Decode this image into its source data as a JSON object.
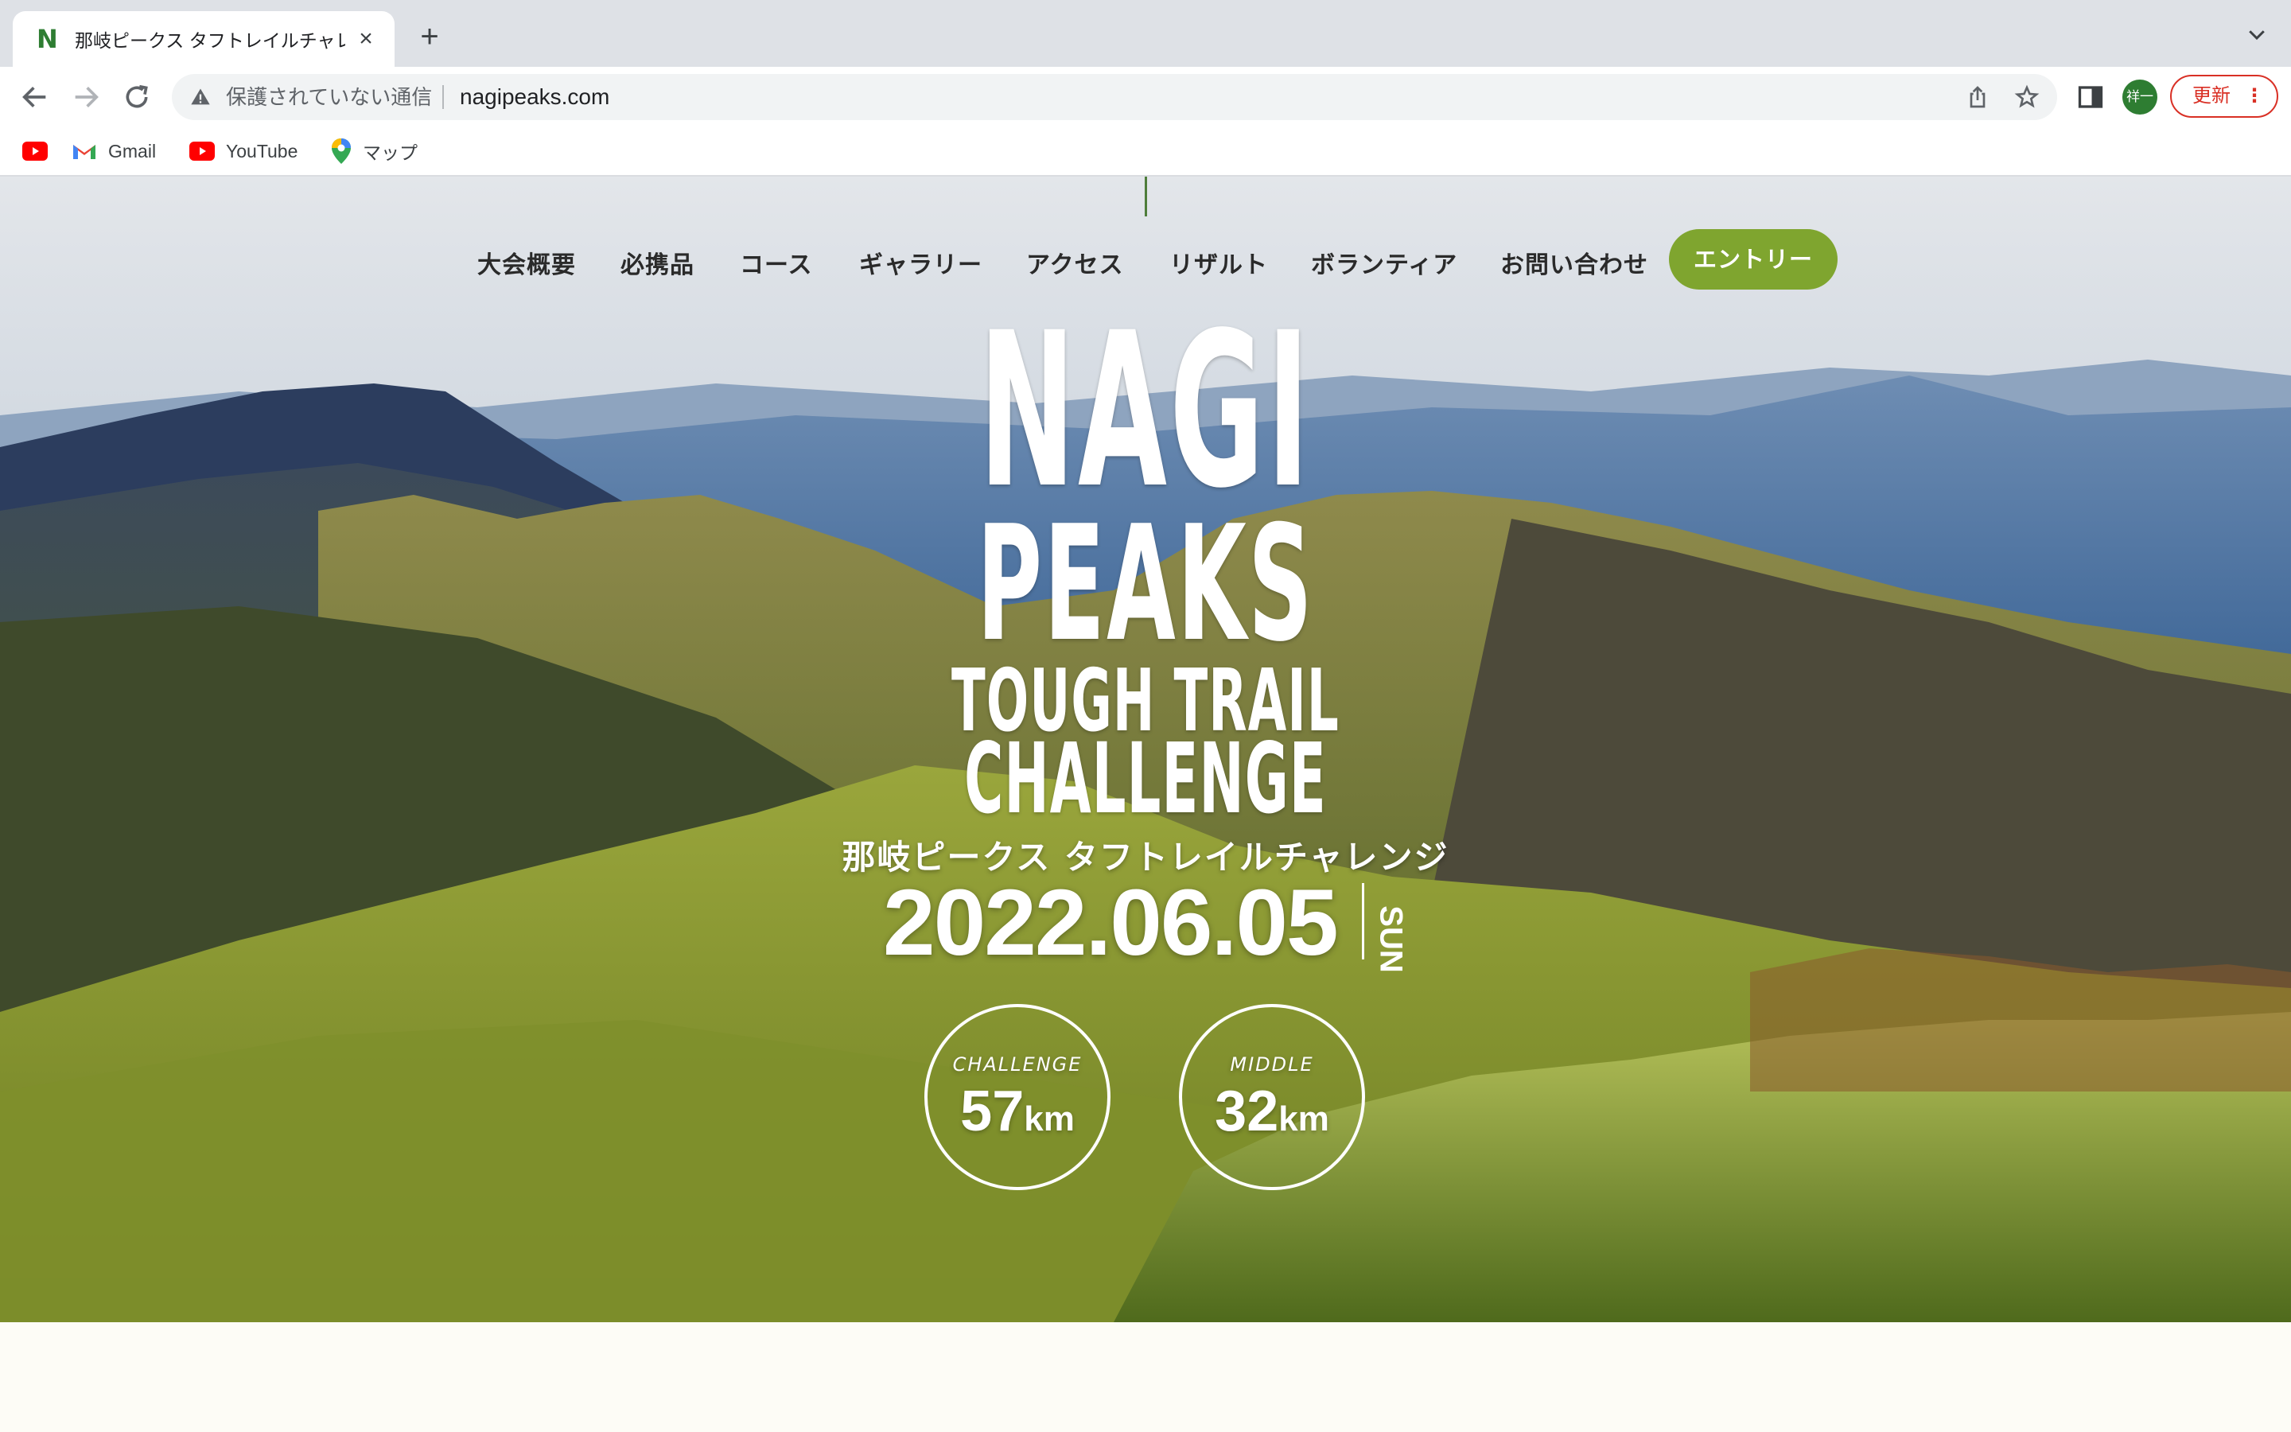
{
  "browser": {
    "tab": {
      "title": "那岐ピークス タフトレイルチャレンジ",
      "favicon_letter": "N"
    },
    "new_tab_symbol": "+",
    "close_symbol": "×",
    "omnibox": {
      "security_label": "保護されていない通信",
      "url": "nagipeaks.com"
    },
    "profile_initial": "祥一",
    "update_label": "更新",
    "update_menu": "⋮",
    "bookmarks": [
      {
        "label": "",
        "icon": "youtube-icon"
      },
      {
        "label": "Gmail",
        "icon": "gmail-icon"
      },
      {
        "label": "YouTube",
        "icon": "youtube-icon"
      },
      {
        "label": "マップ",
        "icon": "maps-icon"
      }
    ]
  },
  "site": {
    "nav": [
      "大会概要",
      "必携品",
      "コース",
      "ギャラリー",
      "アクセス",
      "リザルト",
      "ボランティア",
      "お問い合わせ"
    ],
    "entry_label": "エントリー",
    "logo": {
      "line1": "NAGI",
      "line2": "PEAKS",
      "line3": "TOUGH TRAIL",
      "line4": "CHALLENGE"
    },
    "title_jp": "那岐ピークス タフトレイルチャレンジ",
    "date": "2022.06.05",
    "weekday": "SUN",
    "courses": [
      {
        "name": "CHALLENGE",
        "distance": "57",
        "unit": "km"
      },
      {
        "name": "MIDDLE",
        "distance": "32",
        "unit": "km"
      }
    ]
  },
  "colors": {
    "accent": "#7fa52f",
    "nav_text": "#2a2a2a",
    "update_red": "#d93025"
  }
}
